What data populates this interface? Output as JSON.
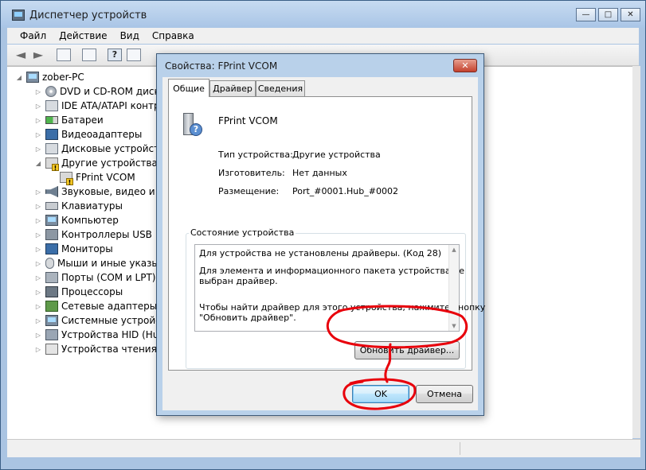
{
  "window": {
    "title": "Диспетчер устройств",
    "min_glyph": "—",
    "max_glyph": "□",
    "close_glyph": "✕"
  },
  "menu": {
    "items": [
      "Файл",
      "Действие",
      "Вид",
      "Справка"
    ]
  },
  "toolbar": {
    "icons": [
      "back-icon",
      "forward-icon",
      "properties-icon",
      "view-icon",
      "help-icon",
      "scan-icon"
    ],
    "help_glyph": "?"
  },
  "tree": {
    "root": "zober-PC",
    "items": [
      {
        "label": "DVD и CD-ROM диско",
        "icon": "disc-icon"
      },
      {
        "label": "IDE ATA/ATAPI контро",
        "icon": "ide-icon"
      },
      {
        "label": "Батареи",
        "icon": "battery-icon"
      },
      {
        "label": "Видеоадаптеры",
        "icon": "display-adapter-icon"
      },
      {
        "label": "Дисковые устройства",
        "icon": "disk-icon"
      },
      {
        "label": "Другие устройства",
        "icon": "other-devices-icon"
      },
      {
        "label": "FPrint VCOM",
        "icon": "warning-device-icon"
      },
      {
        "label": "Звуковые, видео и игр",
        "icon": "sound-icon"
      },
      {
        "label": "Клавиатуры",
        "icon": "keyboard-icon"
      },
      {
        "label": "Компьютер",
        "icon": "computer-icon"
      },
      {
        "label": "Контроллеры USB",
        "icon": "usb-icon"
      },
      {
        "label": "Мониторы",
        "icon": "monitor-icon"
      },
      {
        "label": "Мыши и иные указы",
        "icon": "mouse-icon"
      },
      {
        "label": "Порты (COM и LPT)",
        "icon": "port-icon"
      },
      {
        "label": "Процессоры",
        "icon": "cpu-icon"
      },
      {
        "label": "Сетевые адаптеры",
        "icon": "network-icon"
      },
      {
        "label": "Системные устройства",
        "icon": "system-icon"
      },
      {
        "label": "Устройства HID (Hum",
        "icon": "hid-icon"
      },
      {
        "label": "Устройства чтения см",
        "icon": "card-reader-icon"
      }
    ]
  },
  "dialog": {
    "title": "Свойства: FPrint VCOM",
    "close_glyph": "✕",
    "tabs": [
      "Общие",
      "Драйвер",
      "Сведения"
    ],
    "active_tab": "Общие",
    "device_name": "FPrint VCOM",
    "properties": [
      {
        "label": "Тип устройства:",
        "value": "Другие устройства"
      },
      {
        "label": "Изготовитель:",
        "value": "Нет данных"
      },
      {
        "label": "Размещение:",
        "value": "Port_#0001.Hub_#0002"
      }
    ],
    "status_group_label": "Состояние устройства",
    "status_lines": [
      "Для устройства не установлены драйверы. (Код 28)",
      "Для элемента и информационного пакета устройства не",
      "выбран драйвер.",
      "Чтобы найти драйвер для этого устройства, нажмите кнопку",
      "\"Обновить драйвер\"."
    ],
    "update_driver_button": "Обновить драйвер...",
    "ok_button": "OK",
    "cancel_button": "Отмена"
  },
  "annotation_color": "#e8000b"
}
